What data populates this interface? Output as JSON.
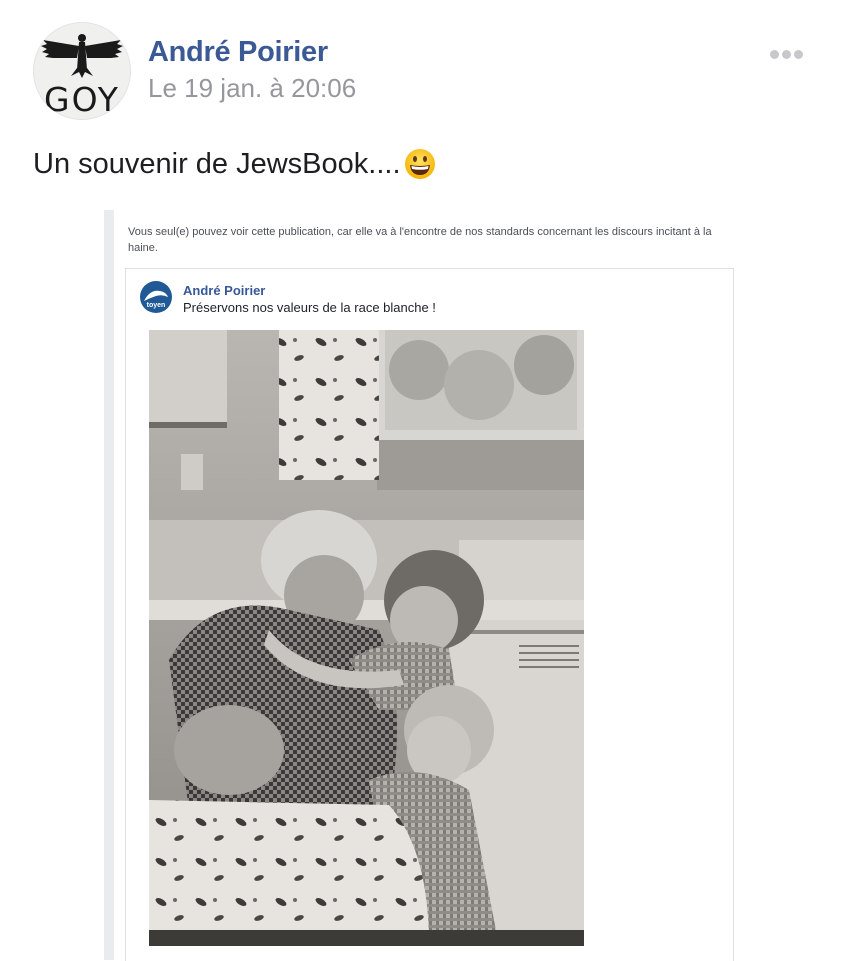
{
  "post": {
    "avatar_label": "GOY",
    "author": "André Poirier",
    "timestamp": "Le 19 jan. à 20:06",
    "text": "Un souvenir de JewsBook....",
    "emoji": "grinning-face-icon",
    "more_icon": "more-horizontal-icon"
  },
  "embedded_screenshot": {
    "notice": "Vous seul(e) pouvez voir cette publication, car elle va à l'encontre de nos standards concernant les discours incitant à la haine.",
    "card": {
      "avatar_label": "toyen",
      "author": "André Poirier",
      "text": "Préservons nos valeurs de la race blanche !"
    }
  },
  "colors": {
    "author_blue": "#3b5a95",
    "timestamp_gray": "#95979c",
    "link_blue": "#365899"
  }
}
